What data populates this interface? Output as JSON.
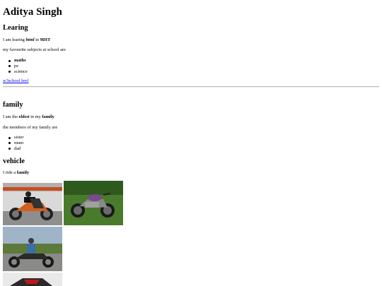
{
  "heading": "Aditya Singh",
  "learning": {
    "title": "Learing",
    "line1": {
      "pre": "I am learing ",
      "em": "html",
      "mid": " in ",
      "strong": "9DIT"
    },
    "subjects_intro": "my favourite subjects at school are",
    "subjects": [
      "maths",
      "pe",
      "science"
    ],
    "link_text": "w3school href"
  },
  "family": {
    "title": "family",
    "line1": {
      "pre": "I am the ",
      "em": "eldest",
      "mid": " in my ",
      "strong": "family"
    },
    "members_intro": "the members of my family are",
    "members": [
      "sister",
      "mum",
      "dad"
    ]
  },
  "vehicle": {
    "title": "vehicle",
    "line1": {
      "pre": "I ride a ",
      "strong": "family"
    },
    "images": [
      "motorcycle-photo-orange",
      "motorcycle-photo-grass",
      "motorcycle-photo-cruiser",
      "motorcycle-photo-red"
    ]
  },
  "colors": {
    "link": "#0000ee"
  }
}
